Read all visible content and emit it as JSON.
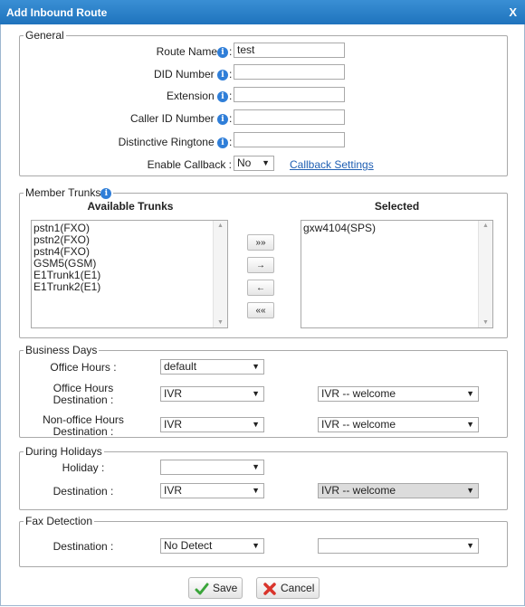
{
  "window": {
    "title": "Add Inbound Route",
    "close_label": "X"
  },
  "general": {
    "legend": "General",
    "route_name_label": "Route Name",
    "route_name_value": "test",
    "did_number_label": "DID Number",
    "did_number_value": "",
    "extension_label": "Extension",
    "extension_value": "",
    "caller_id_label": "Caller ID Number",
    "caller_id_value": "",
    "ringtone_label": "Distinctive Ringtone",
    "ringtone_value": "",
    "callback_label": "Enable Callback :",
    "callback_value": "No",
    "callback_settings_link": "Callback Settings",
    "colon": ":"
  },
  "trunks": {
    "legend": "Member Trunks",
    "available_header": "Available Trunks",
    "selected_header": "Selected",
    "available": [
      "pstn1(FXO)",
      "pstn2(FXO)",
      "pstn4(FXO)",
      "GSM5(GSM)",
      "E1Trunk1(E1)",
      "E1Trunk2(E1)"
    ],
    "selected": [
      "gxw4104(SPS)"
    ],
    "move_all_right": "»»",
    "move_right": "→",
    "move_left": "←",
    "move_all_left": "««"
  },
  "business_days": {
    "legend": "Business Days",
    "office_hours_label": "Office Hours :",
    "office_hours_value": "default",
    "office_dest_label_1": "Office Hours",
    "office_dest_label_2": "Destination :",
    "office_dest_type": "IVR",
    "office_dest_value": "IVR -- welcome",
    "nonoffice_dest_label_1": "Non-office Hours",
    "nonoffice_dest_label_2": "Destination :",
    "nonoffice_dest_type": "IVR",
    "nonoffice_dest_value": "IVR -- welcome"
  },
  "holidays": {
    "legend": "During Holidays",
    "holiday_label": "Holiday :",
    "holiday_value": "",
    "destination_label": "Destination :",
    "destination_type": "IVR",
    "destination_value": "IVR -- welcome"
  },
  "fax": {
    "legend": "Fax Detection",
    "destination_label": "Destination :",
    "destination_type": "No Detect",
    "destination_value": ""
  },
  "buttons": {
    "save": "Save",
    "cancel": "Cancel"
  },
  "colors": {
    "title_bar": "#2a82c9",
    "link": "#1f5fb3",
    "save_icon": "#3aa53a",
    "cancel_icon": "#d9342b"
  }
}
